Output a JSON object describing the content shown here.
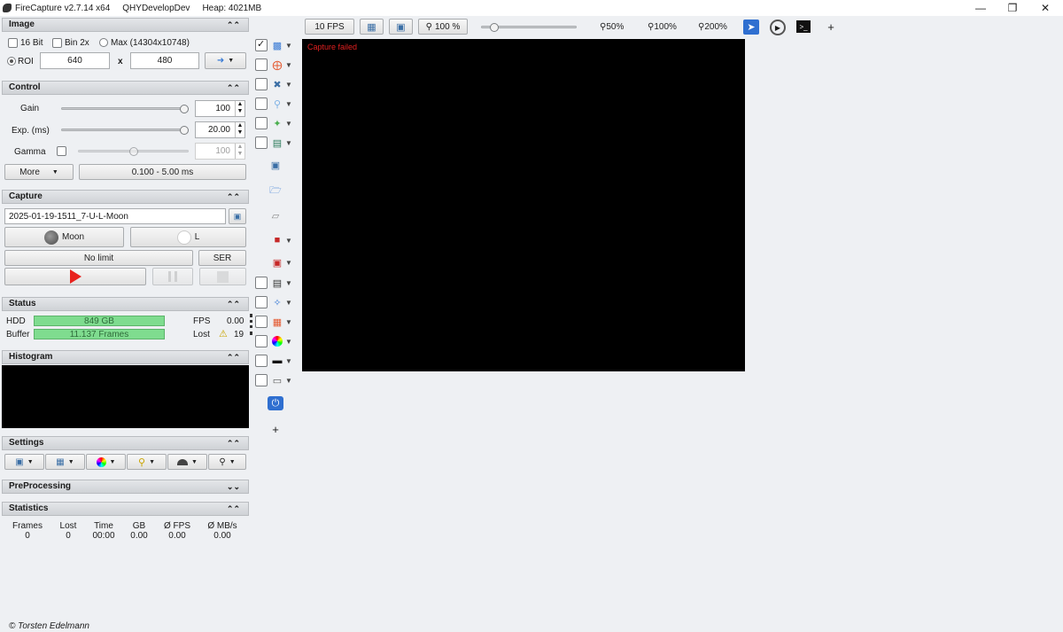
{
  "titlebar": {
    "app": "FireCapture v2.7.14 x64",
    "camera": "QHYDevelopDev",
    "heap": "Heap: 4021MB"
  },
  "image_panel": {
    "title": "Image",
    "bit16_label": "16 Bit",
    "bin2x_label": "Bin 2x",
    "max_label": "Max (14304x10748)",
    "roi_label": "ROI",
    "roi_width": "640",
    "roi_x": "x",
    "roi_height": "480"
  },
  "control_panel": {
    "title": "Control",
    "gain_label": "Gain",
    "gain_value": "100",
    "gain_level": 1.0,
    "exp_label": "Exp. (ms)",
    "exp_value": "20.00",
    "exp_level": 1.0,
    "gamma_label": "Gamma",
    "gamma_value": "100",
    "gamma_level": 0.5,
    "more_label": "More",
    "range_label": "0.100 - 5.00 ms"
  },
  "capture_panel": {
    "title": "Capture",
    "filename": "2025-01-19-1511_7-U-L-Moon",
    "object_label": "Moon",
    "filter_label": "L",
    "limit_label": "No limit",
    "format_label": "SER"
  },
  "status_panel": {
    "title": "Status",
    "hdd_label": "HDD",
    "hdd_value": "849 GB",
    "buffer_label": "Buffer",
    "buffer_value": "11.137 Frames",
    "fps_label": "FPS",
    "fps_value": "0.00",
    "lost_label": "Lost",
    "lost_value": "19"
  },
  "histogram_panel": {
    "title": "Histogram"
  },
  "settings_panel": {
    "title": "Settings"
  },
  "preprocessing_panel": {
    "title": "PreProcessing"
  },
  "statistics_panel": {
    "title": "Statistics",
    "columns": [
      {
        "label": "Frames",
        "value": "0"
      },
      {
        "label": "Lost",
        "value": "0"
      },
      {
        "label": "Time",
        "value": "00:00"
      },
      {
        "label": "GB",
        "value": "0.00"
      },
      {
        "label": "Ø FPS",
        "value": "0.00"
      },
      {
        "label": "Ø MB/s",
        "value": "0.00"
      }
    ]
  },
  "toolbar": {
    "fps_button": "10 FPS",
    "zoom_button": "100 %",
    "zoom50": "50%",
    "zoom100": "100%",
    "zoom200": "200%",
    "add": "+"
  },
  "sidebar_add": "+",
  "canvas": {
    "error": "Capture failed"
  },
  "footer": {
    "copyright": "© Torsten Edelmann"
  }
}
